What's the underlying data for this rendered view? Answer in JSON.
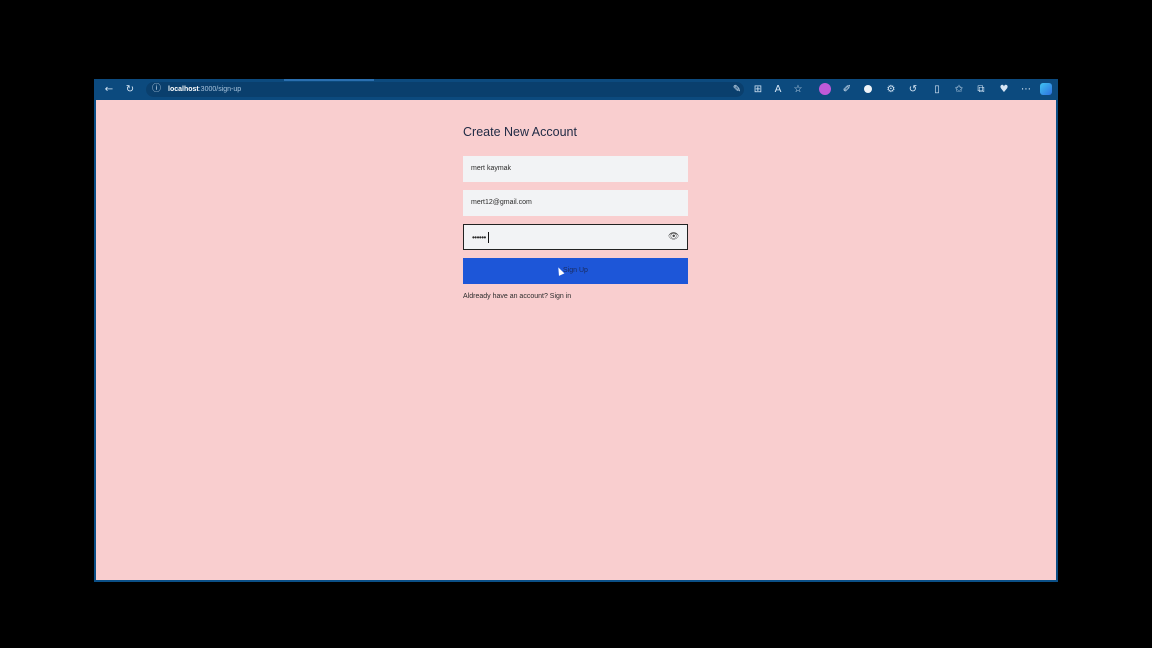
{
  "browser": {
    "address": {
      "host": "localhost",
      "path": ":3000/sign-up"
    },
    "icons": [
      "back-icon",
      "refresh-icon",
      "info-icon",
      "edit-icon",
      "grid-icon",
      "read-aloud-icon",
      "favorite-star-icon",
      "extension-icon",
      "pen-icon",
      "circle-icon",
      "settings-icon",
      "sync-icon",
      "split-screen-icon",
      "favorites-icon",
      "collections-icon",
      "heart-icon",
      "more-icon",
      "copilot-icon"
    ],
    "colors": {
      "frame": "#0c4a7e",
      "page_bg": "#f9cecf"
    }
  },
  "form": {
    "title": "Create New Account",
    "name_value": "mert kaymak",
    "email_value": "mert12@gmail.com",
    "password_value": "••••••",
    "submit_label": "Sign Up",
    "signin_prompt": "Aldready have an account?",
    "signin_link": "Sign in",
    "button_color": "#1d56d8"
  }
}
